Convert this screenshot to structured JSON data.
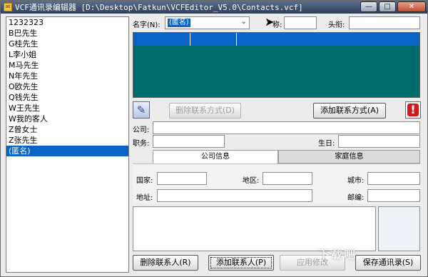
{
  "window": {
    "title": "VCF通讯录编辑器 [D:\\Desktop\\Fatkun\\VCFEditor_V5.0\\Contacts.vcf]",
    "minimize": "—",
    "maximize": "□",
    "close": "✕"
  },
  "contacts": [
    "1232323",
    "B巴先生",
    "G桂先生",
    "L李小姐",
    "M马先生",
    "N年先生",
    "O欧先生",
    "Q钱先生",
    "W王先生",
    "W我的客人",
    "Z曾女士",
    "Z张先生",
    "(匿名)"
  ],
  "selected_contact_index": 12,
  "form": {
    "name_label": "名字(N):",
    "name_value": "(匿名)",
    "nickname_label": "称:",
    "nickname_value": "",
    "title_label": "头衔:",
    "title_value": "",
    "company_label": "公司:",
    "company_value": "",
    "position_label": "职务:",
    "position_value": "",
    "birthday_label": "生日:",
    "birthday_value": ""
  },
  "contact_methods_grid": {
    "columns": [
      "",
      "",
      ""
    ]
  },
  "buttons": {
    "delete_method": "删除联系方式(D)",
    "add_method": "添加联系方式(A)",
    "delete_contact": "删除联系人(R)",
    "add_contact": "添加联系人(P)",
    "apply_changes": "应用修改",
    "save_contacts": "保存通讯录(S)"
  },
  "tabs": {
    "company_info": "公司信息",
    "home_info": "家庭信息",
    "active": "company_info"
  },
  "address": {
    "country_label": "国家:",
    "country_value": "",
    "region_label": "地区:",
    "region_value": "",
    "city_label": "城市:",
    "city_value": "",
    "street_label": "地址:",
    "street_value": "",
    "postcode_label": "邮编:",
    "postcode_value": ""
  },
  "icons": {
    "tools": "wrench-screwdriver-icon",
    "alert": "exclamation-icon",
    "app": "vcf-app-icon"
  },
  "watermark": "下载吧"
}
